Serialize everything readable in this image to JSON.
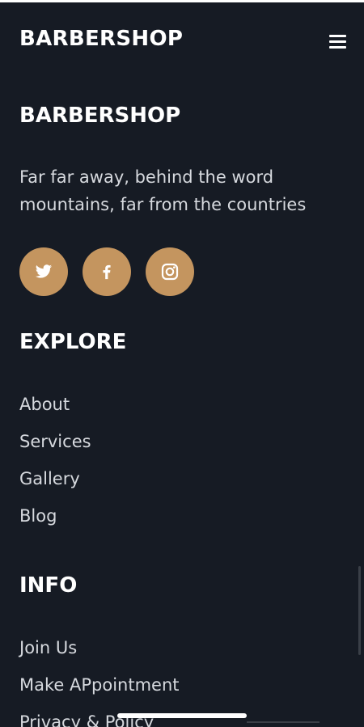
{
  "navbar": {
    "brand": "BARBERSHOP",
    "menu_icon": "hamburger-menu-icon"
  },
  "footer": {
    "about": {
      "heading": "BARBERSHOP",
      "text": "Far far away, behind the word mountains, far from the countries"
    },
    "socials": [
      {
        "name": "Twitter",
        "icon": "twitter-icon"
      },
      {
        "name": "Facebook",
        "icon": "facebook-icon"
      },
      {
        "name": "Instagram",
        "icon": "instagram-icon"
      }
    ],
    "explore": {
      "heading": "EXPLORE",
      "links": [
        "About",
        "Services",
        "Gallery",
        "Blog"
      ]
    },
    "info": {
      "heading": "INFO",
      "links": [
        "Join Us",
        "Make APpointment",
        "Privacy & Policy"
      ]
    }
  },
  "colors": {
    "background": "#161b24",
    "accent": "#c4955f",
    "text": "#ffffff",
    "muted_text": "#d6d9de"
  }
}
